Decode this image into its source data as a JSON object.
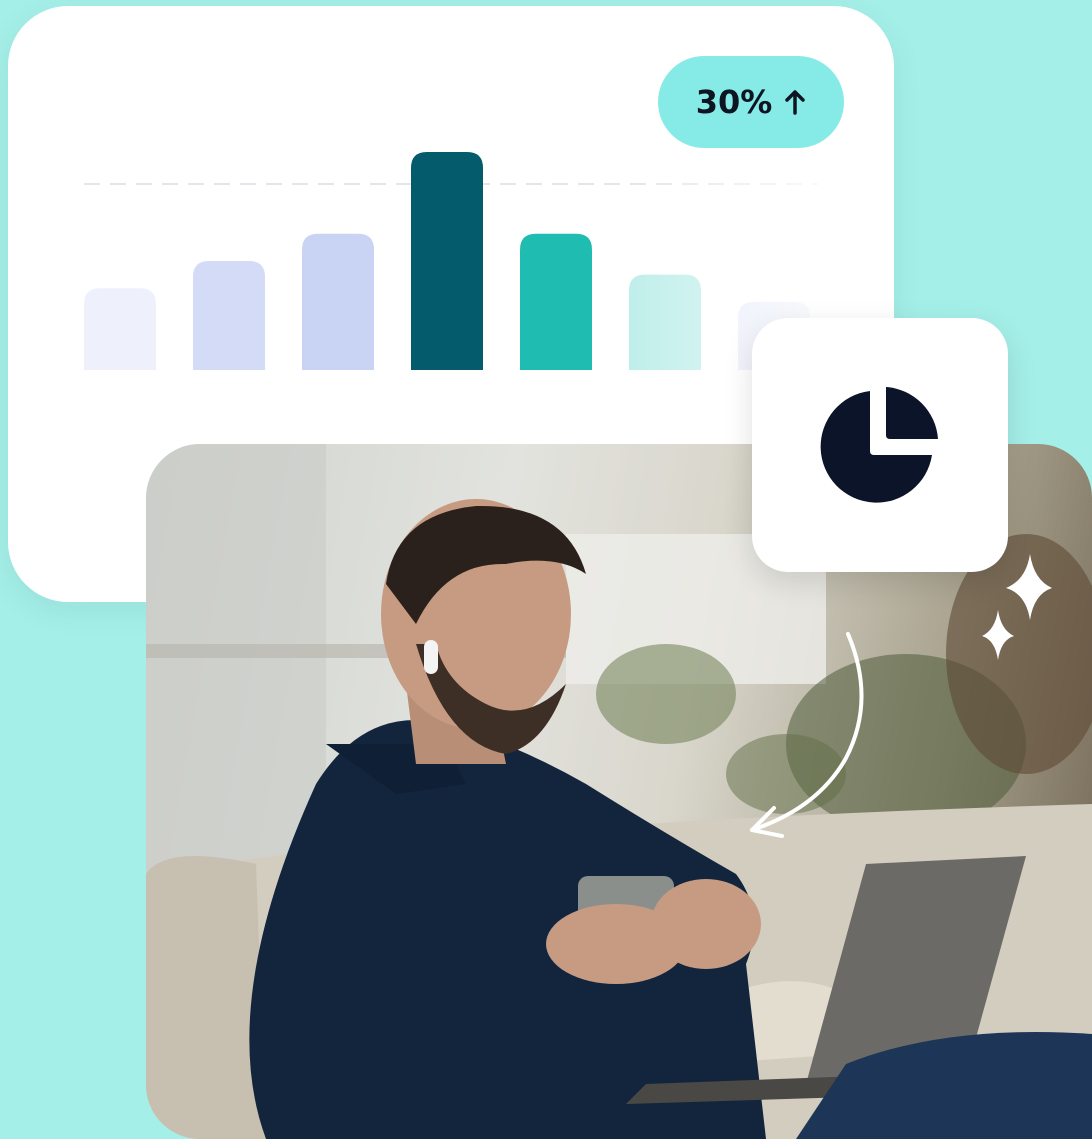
{
  "badge": {
    "label": "30%",
    "icon": "arrow-up-icon"
  },
  "chart_data": {
    "type": "bar",
    "categories": [
      "",
      "",
      "",
      "",
      "",
      "",
      ""
    ],
    "values": [
      30,
      40,
      50,
      80,
      50,
      35,
      25
    ],
    "reference_line": 70,
    "ylim": [
      0,
      80
    ],
    "grid": false,
    "colors": [
      "#eef0fb",
      "#d3dbf6",
      "#c9d4f5",
      "#045b6b",
      "#1fbdb1",
      "#bfeeea",
      "#e6ebfa"
    ]
  },
  "tile": {
    "icon": "pie-chart-icon",
    "color": "#0b1429"
  },
  "decorations": {
    "sparkle_icon": "sparkle-icon",
    "arrow_icon": "curved-arrow-icon"
  },
  "photo": {
    "subject": "man-on-sofa-with-laptop"
  },
  "colors": {
    "background": "#a5efe9",
    "card": "#ffffff",
    "badge": "#86ebe6"
  }
}
